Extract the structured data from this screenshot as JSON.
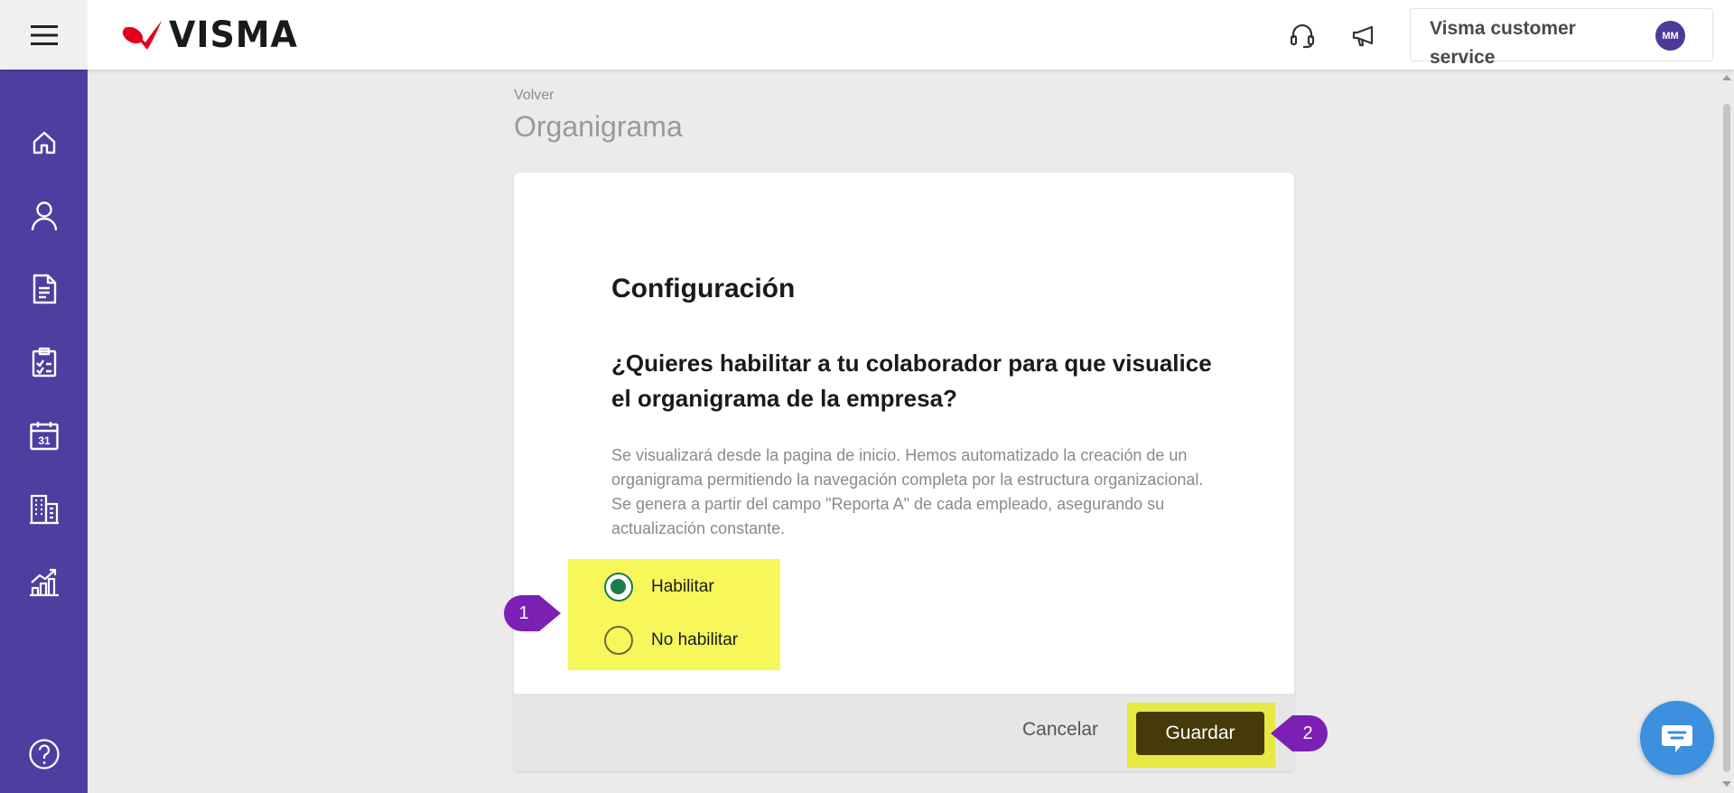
{
  "brand": {
    "name": "VISMA"
  },
  "header": {
    "user_name": "Visma customer service",
    "avatar_initials": "MM",
    "icons": [
      "menu-icon",
      "headset-icon",
      "megaphone-icon"
    ]
  },
  "sidebar": {
    "items": [
      {
        "icon": "home-icon"
      },
      {
        "icon": "user-icon"
      },
      {
        "icon": "document-icon"
      },
      {
        "icon": "clipboard-check-icon"
      },
      {
        "icon": "calendar-icon",
        "text": "31"
      },
      {
        "icon": "building-icon"
      },
      {
        "icon": "chart-growth-icon"
      },
      {
        "icon": "help-icon"
      }
    ]
  },
  "breadcrumb": {
    "back_label": "Volver"
  },
  "page": {
    "title": "Organigrama"
  },
  "card": {
    "heading": "Configuración",
    "question": "¿Quieres habilitar a tu colaborador para que visualice el organigrama de la empresa?",
    "description": "Se visualizará desde la pagina de inicio. Hemos automatizado la creación de un organigrama permitiendo la navegación completa por la estructura organizacional. Se genera a partir del campo \"Reporta A\" de cada empleado, asegurando su actualización constante.",
    "options": [
      {
        "label": "Habilitar",
        "selected": true
      },
      {
        "label": "No habilitar",
        "selected": false
      }
    ],
    "cancel_label": "Cancelar",
    "save_label": "Guardar"
  },
  "callouts": [
    {
      "number": "1"
    },
    {
      "number": "2"
    }
  ],
  "colors": {
    "sidebar": "#4d3fa0",
    "highlight": "#f7f65a",
    "save_button": "#463a0a",
    "callout": "#7b1fb5",
    "radio_checked": "#1d7a4a",
    "chat": "#3d8fe0",
    "brand_red": "#e2001a"
  }
}
